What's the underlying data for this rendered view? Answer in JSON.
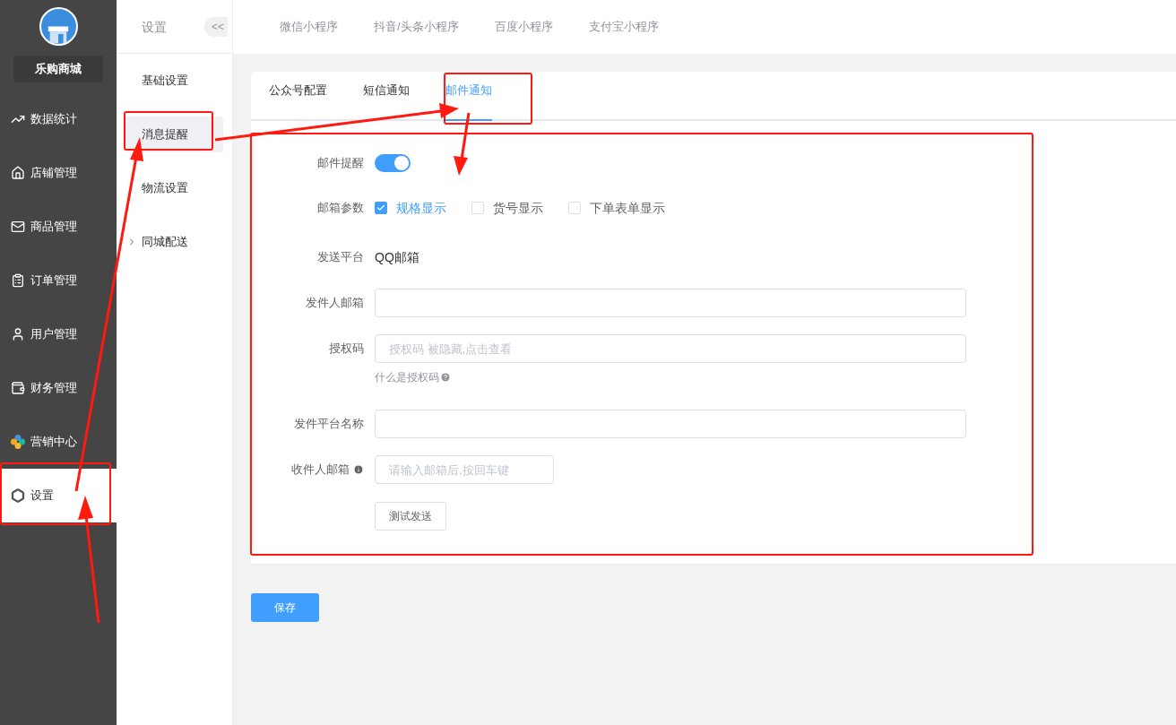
{
  "sidebar": {
    "store_name": "乐购商城",
    "items": [
      {
        "label": "数据统计",
        "selected": false
      },
      {
        "label": "店铺管理",
        "selected": false
      },
      {
        "label": "商品管理",
        "selected": false
      },
      {
        "label": "订单管理",
        "selected": false
      },
      {
        "label": "用户管理",
        "selected": false
      },
      {
        "label": "财务管理",
        "selected": false
      },
      {
        "label": "营销中心",
        "selected": false
      },
      {
        "label": "设置",
        "selected": true
      }
    ]
  },
  "subnav": {
    "title": "设置",
    "collapse": "<<",
    "items": [
      {
        "label": "基础设置",
        "kind": "link",
        "selected": false
      },
      {
        "label": "消息提醒",
        "kind": "link",
        "selected": true
      },
      {
        "label": "物流设置",
        "kind": "link",
        "selected": false
      },
      {
        "label": "同城配送",
        "kind": "group",
        "selected": false
      }
    ]
  },
  "top_tabs": [
    "微信小程序",
    "抖音/头条小程序",
    "百度小程序",
    "支付宝小程序"
  ],
  "tabs": [
    {
      "label": "公众号配置",
      "selected": false
    },
    {
      "label": "短信通知",
      "selected": false
    },
    {
      "label": "邮件通知",
      "selected": true
    }
  ],
  "form": [
    {
      "kind": "switch",
      "label": "邮件提醒",
      "on": true
    },
    {
      "kind": "checkboxes",
      "label": "邮箱参数",
      "options": [
        {
          "label": "规格显示",
          "checked": true
        },
        {
          "label": "货号显示",
          "checked": false
        },
        {
          "label": "下单表单显示",
          "checked": false
        }
      ]
    },
    {
      "kind": "text",
      "label": "发送平台",
      "value": "QQ邮箱"
    },
    {
      "kind": "input",
      "label": "发件人邮箱"
    },
    {
      "kind": "input",
      "label": "授权码",
      "placeholder": "授权码 被隐藏,点击查看",
      "help": "什么是授权码"
    },
    {
      "kind": "input",
      "label": "发件平台名称"
    },
    {
      "kind": "tags",
      "label": "收件人邮箱",
      "placeholder": "请输入邮箱后,按回车键"
    },
    {
      "kind": "button",
      "label": "测试发送"
    }
  ],
  "save_button": "保存"
}
